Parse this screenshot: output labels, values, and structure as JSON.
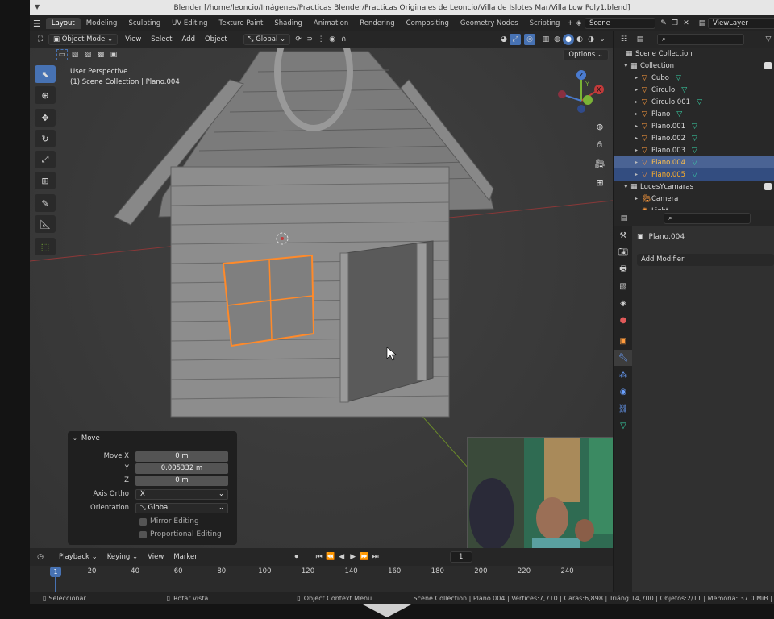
{
  "window": {
    "title": "Blender [/home/leoncio/Imágenes/Practicas Blender/Practicas Originales de Leoncio/Villa de Islotes Mar/Villa Low Poly1.blend]"
  },
  "workspaces": [
    {
      "label": "Layout",
      "active": true
    },
    {
      "label": "Modeling"
    },
    {
      "label": "Sculpting"
    },
    {
      "label": "UV Editing"
    },
    {
      "label": "Texture Paint"
    },
    {
      "label": "Shading"
    },
    {
      "label": "Animation"
    },
    {
      "label": "Rendering"
    },
    {
      "label": "Compositing"
    },
    {
      "label": "Geometry Nodes"
    },
    {
      "label": "Scripting"
    }
  ],
  "topbar": {
    "scene": "Scene",
    "view_layer": "ViewLayer"
  },
  "viewport_header": {
    "mode": "Object Mode",
    "menus": [
      "View",
      "Select",
      "Add",
      "Object"
    ],
    "orientation": "Global",
    "options": "Options"
  },
  "viewport": {
    "perspective": "User Perspective",
    "context": "(1) Scene Collection | Plano.004"
  },
  "gizmo": {
    "x": "X",
    "y": "Y",
    "z": "Z"
  },
  "move_panel": {
    "title": "Move",
    "move_x_label": "Move X",
    "move_x": "0 m",
    "y_label": "Y",
    "y": "0.005332 m",
    "z_label": "Z",
    "z": "0 m",
    "axis_ortho_label": "Axis Ortho",
    "axis_ortho": "X",
    "orientation_label": "Orientation",
    "orientation": "Global",
    "mirror_editing": "Mirror Editing",
    "proportional_editing": "Proportional Editing"
  },
  "outliner": {
    "root": "Scene Collection",
    "collection": "Collection",
    "items": [
      {
        "name": "Cubo",
        "state": ""
      },
      {
        "name": "Circulo",
        "state": ""
      },
      {
        "name": "Circulo.001",
        "state": ""
      },
      {
        "name": "Plano",
        "state": ""
      },
      {
        "name": "Plano.001",
        "state": ""
      },
      {
        "name": "Plano.002",
        "state": ""
      },
      {
        "name": "Plano.003",
        "state": ""
      },
      {
        "name": "Plano.004",
        "state": "active"
      },
      {
        "name": "Plano.005",
        "state": "selected"
      }
    ],
    "collection2": "LucesYcamaras",
    "items2": [
      "Camera",
      "Light"
    ]
  },
  "properties": {
    "object_name": "Plano.004",
    "add_modifier": "Add Modifier"
  },
  "timeline": {
    "menus": [
      "Playback",
      "Keying",
      "View",
      "Marker"
    ],
    "current_frame": "1",
    "ticks": [
      "20",
      "40",
      "60",
      "80",
      "100",
      "120",
      "140",
      "160",
      "180",
      "200",
      "220",
      "240"
    ]
  },
  "statusbar": {
    "select": "Seleccionar",
    "rotate": "Rotar vista",
    "context_menu": "Object Context Menu",
    "stats": "Scene Collection | Plano.004 | Vértices:7,710 | Caras:6,898 | Triáng:14,700 | Objetos:2/11 | Memoria: 37.0 MiB |"
  },
  "colors": {
    "selection_orange": "#ff8a2a",
    "active_blue": "#4772b3",
    "axis_red": "#c23a3a",
    "axis_green": "#7ab336"
  }
}
